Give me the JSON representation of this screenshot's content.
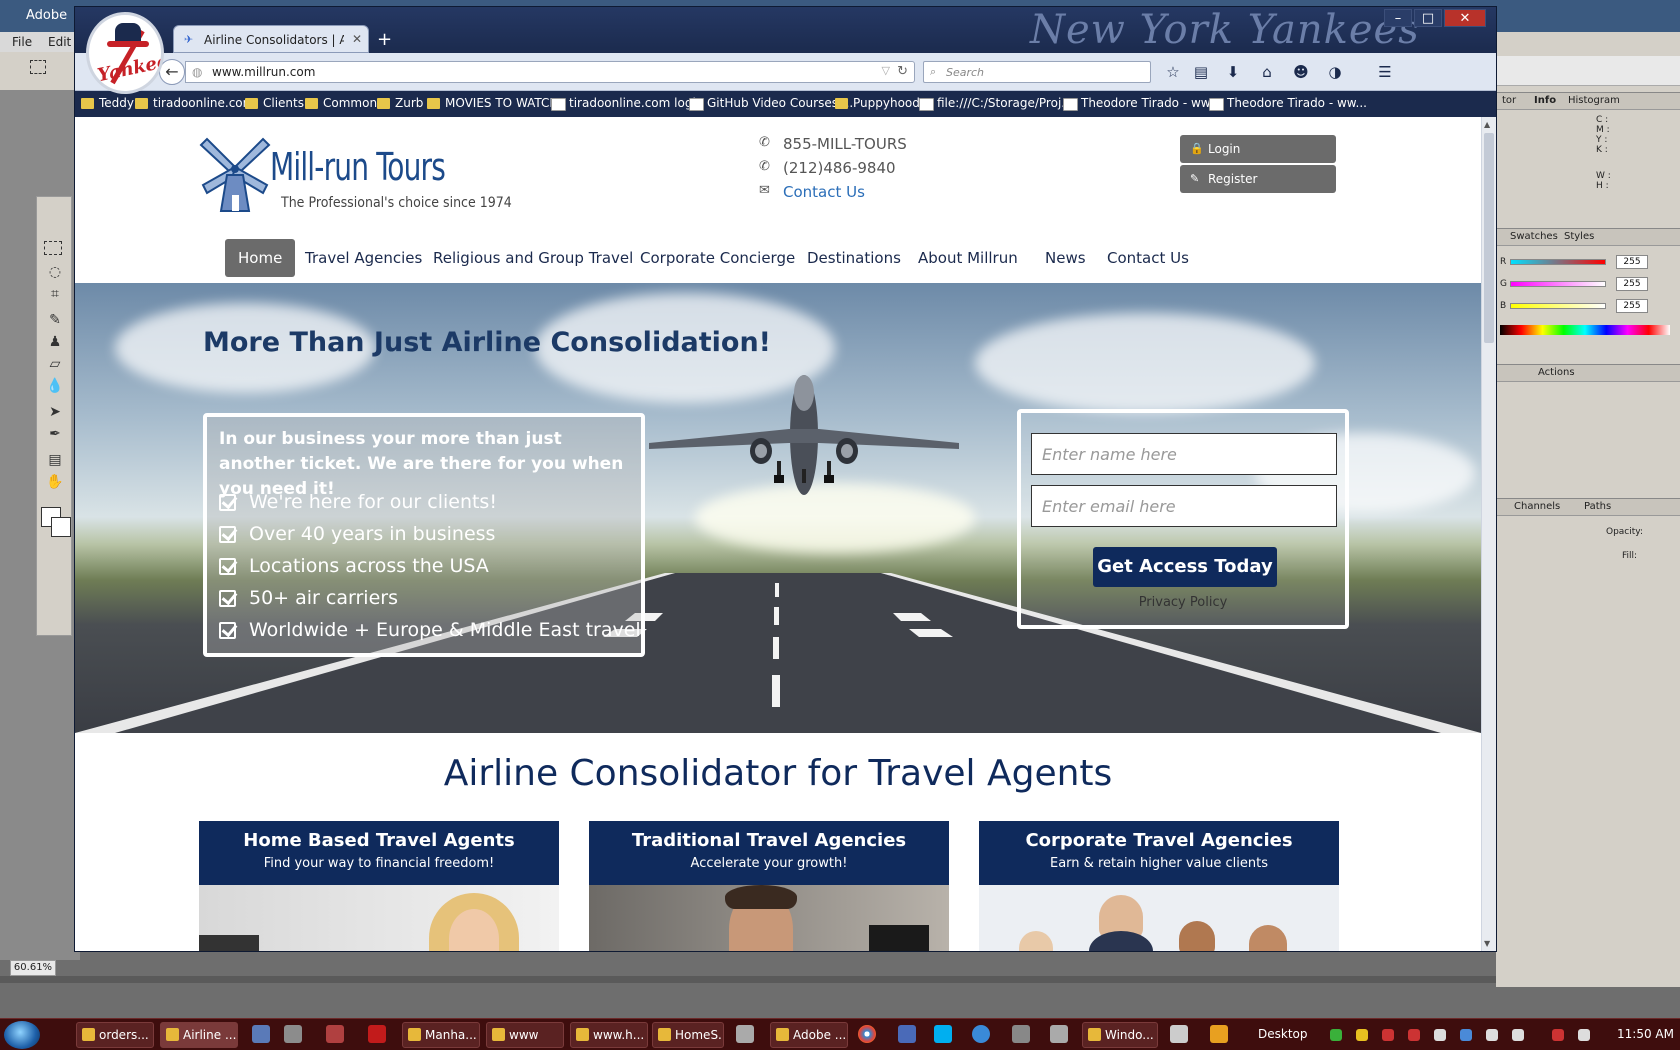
{
  "photoshop": {
    "title": "Adobe",
    "menu": [
      "File",
      "Edit"
    ],
    "zoom": "60.61%",
    "panels": {
      "info_tabs": [
        "tor",
        "Info",
        "Histogram"
      ],
      "info_labels": [
        "C :",
        "M :",
        "Y :",
        "K :",
        "W :",
        "H :"
      ],
      "swatches_tabs": [
        "Swatches",
        "Styles"
      ],
      "color_labels": [
        "R",
        "G",
        "B"
      ],
      "color_values": [
        "255",
        "255",
        "255"
      ],
      "actions_tab": "Actions",
      "channels_tabs": [
        "Channels",
        "Paths"
      ],
      "opacity_label": "Opacity:",
      "fill_label": "Fill:"
    }
  },
  "browser": {
    "wordmark": "New York Yankees",
    "tab_title": "Airline Consolidators | Airli...",
    "url": "www.millrun.com",
    "search_placeholder": "Search",
    "bookmarks": [
      {
        "label": "Teddy",
        "type": "folder"
      },
      {
        "label": "tiradoonline.com",
        "type": "folder"
      },
      {
        "label": "Clients",
        "type": "folder"
      },
      {
        "label": "Common",
        "type": "folder"
      },
      {
        "label": "Zurb",
        "type": "folder"
      },
      {
        "label": "MOVIES TO WATCH",
        "type": "folder"
      },
      {
        "label": "tiradoonline.com login",
        "type": "page"
      },
      {
        "label": "GitHub Video Courses ...",
        "type": "page"
      },
      {
        "label": "Puppyhood",
        "type": "folder"
      },
      {
        "label": "file:///C:/Storage/Proj...",
        "type": "page"
      },
      {
        "label": "Theodore Tirado - ww...",
        "type": "page"
      },
      {
        "label": "Theodore Tirado - ww...",
        "type": "page"
      }
    ]
  },
  "site": {
    "logo_title": "Mill-run Tours",
    "logo_tagline": "The Professional's choice since 1974",
    "phone1": "855-MILL-TOURS",
    "phone2": "(212)486-9840",
    "contact_link": "Contact Us",
    "login": "Login",
    "register": "Register",
    "nav": [
      "Home",
      "Travel Agencies",
      "Religious and Group Travel",
      "Corporate Concierge",
      "Destinations",
      "About Millrun",
      "News",
      "Contact Us"
    ],
    "hero": {
      "title": "More Than Just Airline Consolidation!",
      "intro": "In our business your more than just another ticket. We are there for you when you need it!",
      "bullets": [
        "We're here for our clients!",
        "Over 40 years in business",
        "Locations across the USA",
        "50+ air carriers",
        "Worldwide + Europe & Middle East travel"
      ],
      "name_placeholder": "Enter name here",
      "email_placeholder": "Enter email here",
      "cta": "Get Access Today",
      "privacy": "Privacy Policy"
    },
    "section_title": "Airline Consolidator for Travel Agents",
    "cards": [
      {
        "title": "Home Based Travel Agents",
        "subtitle": "Find your way to financial freedom!"
      },
      {
        "title": "Traditional Travel Agencies",
        "subtitle": "Accelerate your growth!"
      },
      {
        "title": "Corporate Travel Agencies",
        "subtitle": "Earn & retain higher value clients"
      }
    ]
  },
  "taskbar": {
    "items": [
      "orders...",
      "Airline ...",
      "Manha...",
      "www",
      "www.h...",
      "HomeS...",
      "Adobe ...",
      "Windo..."
    ],
    "desktop_label": "Desktop",
    "clock": "11:50 AM"
  },
  "colors": {
    "navy": "#0f2a5c",
    "brand_blue": "#1c4a8a",
    "nav_active": "#6b6b6b",
    "taskbar": "#3e0d0d"
  }
}
